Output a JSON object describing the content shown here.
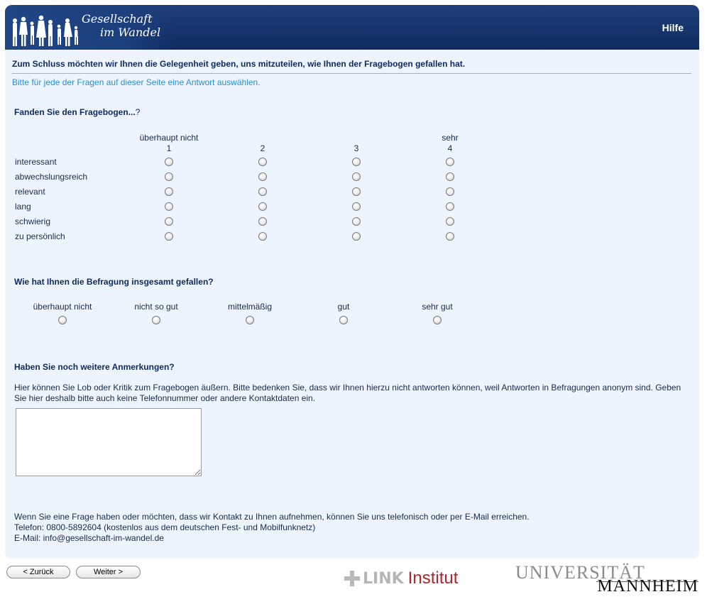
{
  "header": {
    "logo_line1": "Gesellschaft",
    "logo_line2": "im Wandel",
    "help_label": "Hilfe"
  },
  "intro": "Zum Schluss möchten wir Ihnen die Gelegenheit geben, uns mitzuteilen, wie Ihnen der Fragebogen gefallen hat.",
  "hint": "Bitte für jede der Fragen auf dieser Seite eine Antwort auswählen.",
  "q1": {
    "title": "Fanden Sie den Fragebogen...",
    "title_suffix": "?",
    "scale": [
      {
        "top": "überhaupt nicht",
        "num": "1"
      },
      {
        "top": "",
        "num": "2"
      },
      {
        "top": "",
        "num": "3"
      },
      {
        "top": "sehr",
        "num": "4"
      }
    ],
    "rows": [
      "interessant",
      "abwechslungsreich",
      "relevant",
      "lang",
      "schwierig",
      "zu persönlich"
    ]
  },
  "q2": {
    "title": "Wie hat Ihnen die Befragung insgesamt gefallen?",
    "options": [
      "überhaupt nicht",
      "nicht so gut",
      "mittelmäßig",
      "gut",
      "sehr gut"
    ]
  },
  "q3": {
    "title": "Haben Sie noch weitere Anmerkungen?",
    "text": "Hier können Sie Lob oder Kritik zum Fragebogen äußern. Bitte bedenken Sie, dass wir Ihnen hierzu nicht antworten können, weil Antworten in Befragungen anonym sind. Geben Sie hier deshalb bitte auch keine Telefonnummer oder andere Kontaktdaten ein.",
    "comment_value": ""
  },
  "contact": {
    "line1": "Wenn Sie eine Frage haben oder möchten, dass wir Kontakt zu Ihnen aufnehmen, können Sie uns telefonisch oder per E-Mail erreichen.",
    "line2": "Telefon: 0800-5892604 (kostenlos aus dem deutschen Fest- und Mobilfunknetz)",
    "line3": "E-Mail: info@gesellschaft-im-wandel.de"
  },
  "nav": {
    "back_label": "< Zurück",
    "next_label": "Weiter >"
  },
  "footer": {
    "link_word": "LINK",
    "link_inst": "Institut",
    "uni_top": "UNIVERSITÄT",
    "uni_bottom": "MANNHEIM"
  }
}
